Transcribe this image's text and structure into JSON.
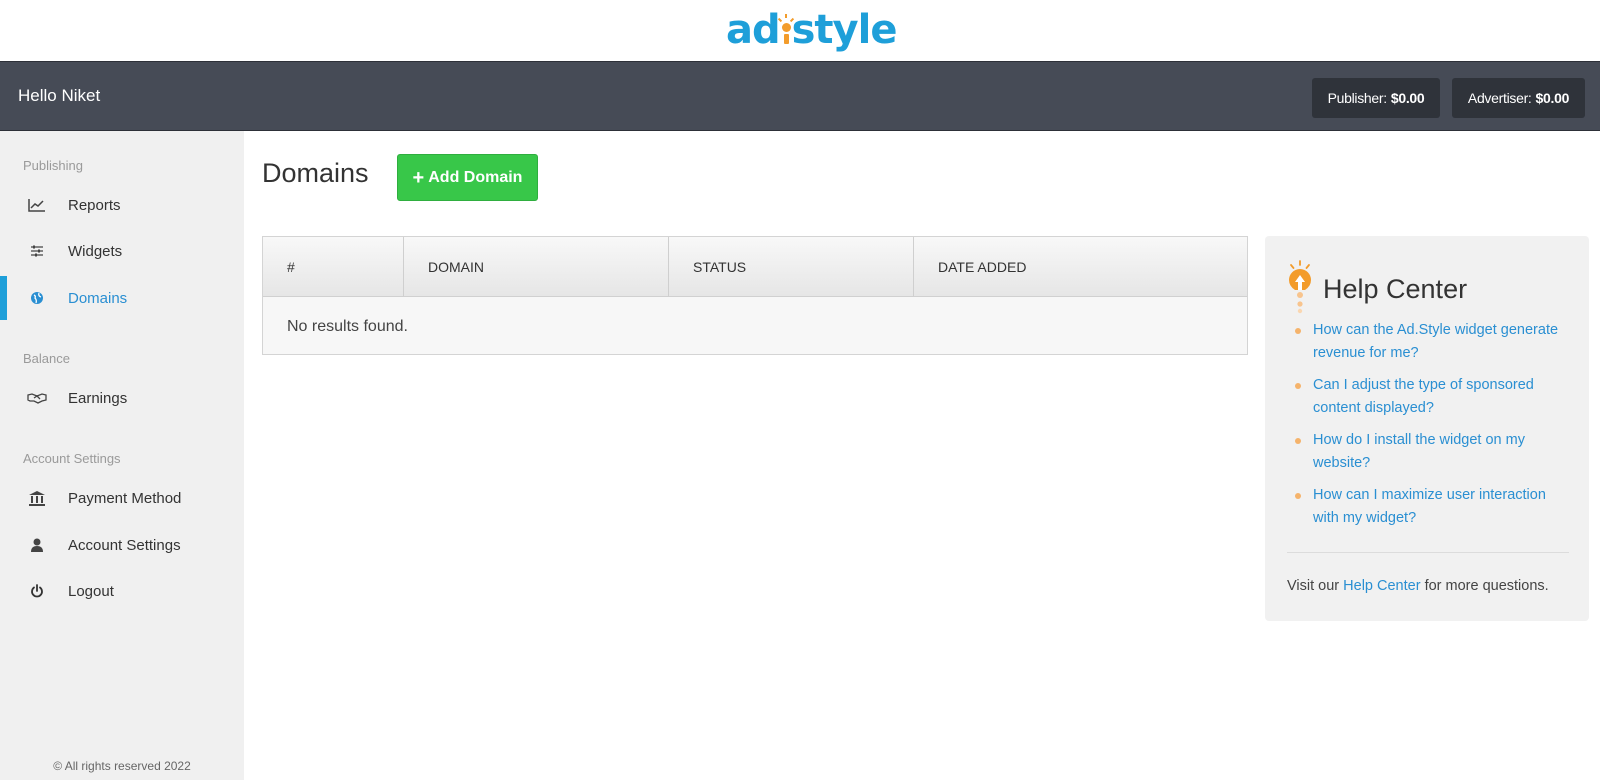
{
  "brand": {
    "logo_text_left": "ad",
    "logo_text_right": "style",
    "colors": {
      "blue": "#1e9fd9",
      "orange": "#f39c2b"
    }
  },
  "topnav": {
    "greeting": "Hello Niket",
    "publisher_label": "Publisher:",
    "publisher_value": "$0.00",
    "advertiser_label": "Advertiser:",
    "advertiser_value": "$0.00"
  },
  "sidebar": {
    "sections": [
      {
        "title": "Publishing",
        "items": [
          {
            "label": "Reports",
            "icon": "line-chart-icon"
          },
          {
            "label": "Widgets",
            "icon": "sliders-icon"
          },
          {
            "label": "Domains",
            "icon": "globe-icon",
            "active": true
          }
        ]
      },
      {
        "title": "Balance",
        "items": [
          {
            "label": "Earnings",
            "icon": "handshake-icon"
          }
        ]
      },
      {
        "title": "Account Settings",
        "items": [
          {
            "label": "Payment Method",
            "icon": "bank-icon"
          },
          {
            "label": "Account Settings",
            "icon": "user-icon"
          },
          {
            "label": "Logout",
            "icon": "power-icon"
          }
        ]
      }
    ],
    "copyright": "© All rights reserved 2022"
  },
  "main": {
    "title": "Domains",
    "add_button": "Add Domain",
    "table": {
      "columns": [
        "#",
        "DOMAIN",
        "STATUS",
        "DATE ADDED"
      ],
      "rows": [],
      "empty_text": "No results found."
    }
  },
  "help": {
    "title": "Help Center",
    "links": [
      "How can the Ad.Style widget generate revenue for me?",
      "Can I adjust the type of sponsored content displayed?",
      "How do I install the widget on my website?",
      "How can I maximize user interaction with my widget?"
    ],
    "footer_prefix": "Visit our",
    "footer_link": "Help Center",
    "footer_suffix": "for more questions."
  }
}
